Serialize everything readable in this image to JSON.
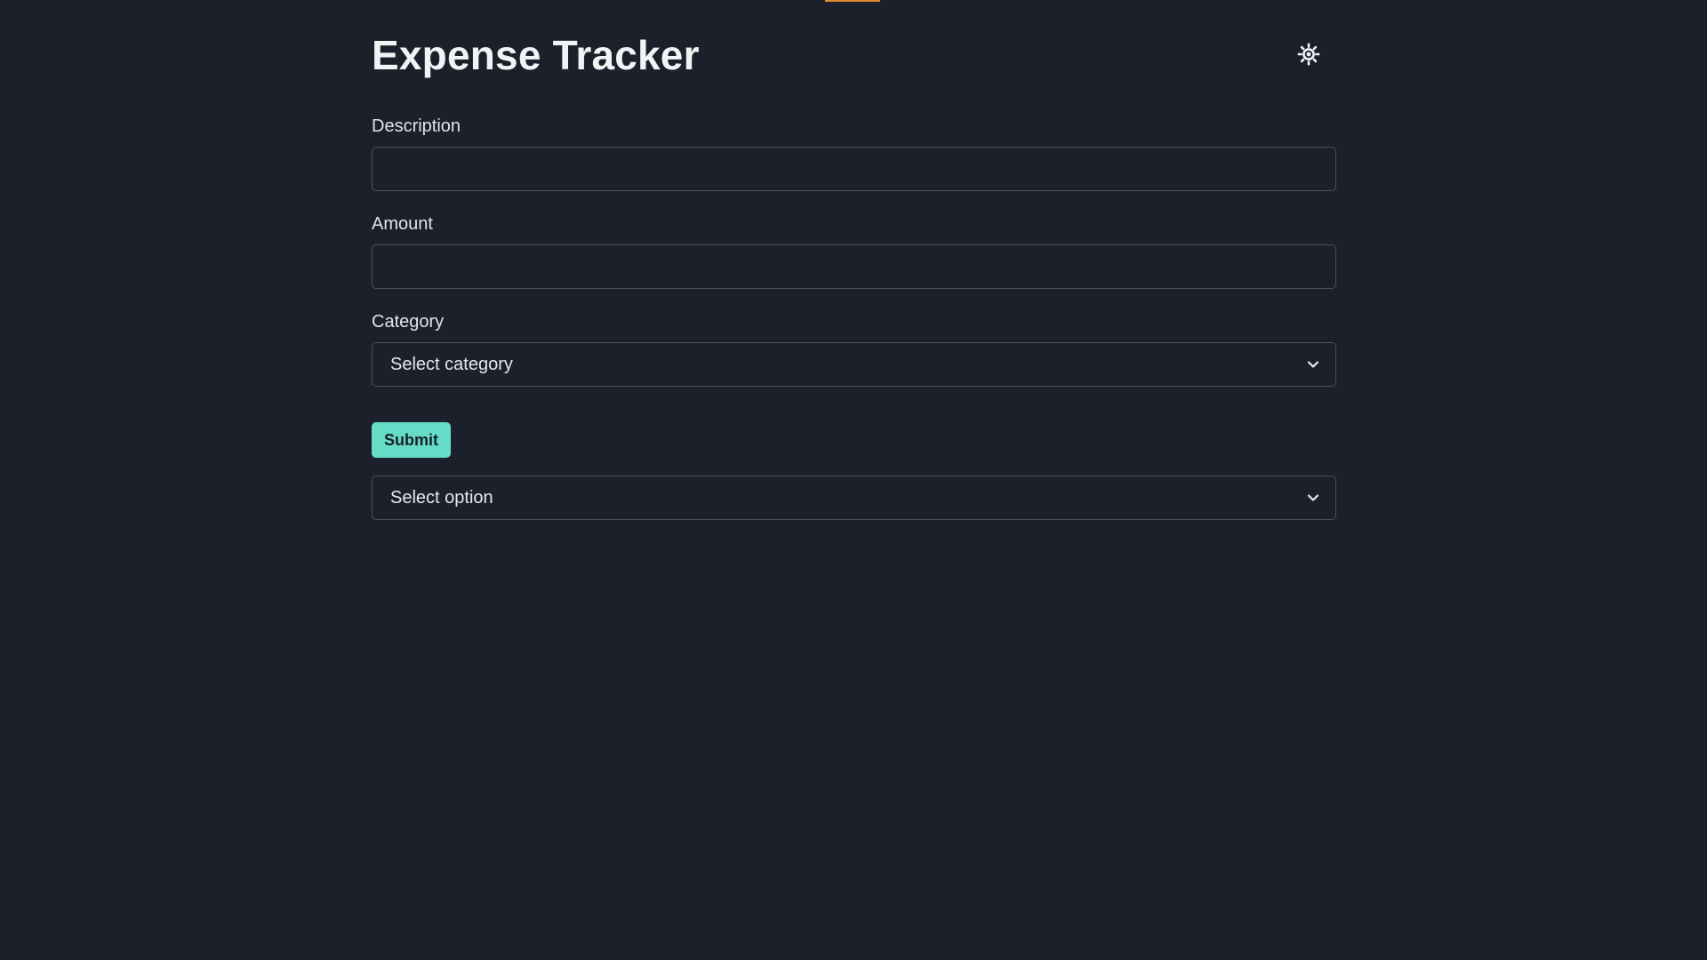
{
  "app": {
    "title": "Expense Tracker",
    "accent_color": "#66dcc8",
    "top_accent_color": "#e08a2e",
    "theme_toggle_icon": "sun-icon"
  },
  "form": {
    "description": {
      "label": "Description",
      "value": "",
      "placeholder": ""
    },
    "amount": {
      "label": "Amount",
      "value": "",
      "placeholder": ""
    },
    "category": {
      "label": "Category",
      "selected": "Select category"
    },
    "submit_label": "Submit"
  },
  "option_select": {
    "selected": "Select option"
  }
}
